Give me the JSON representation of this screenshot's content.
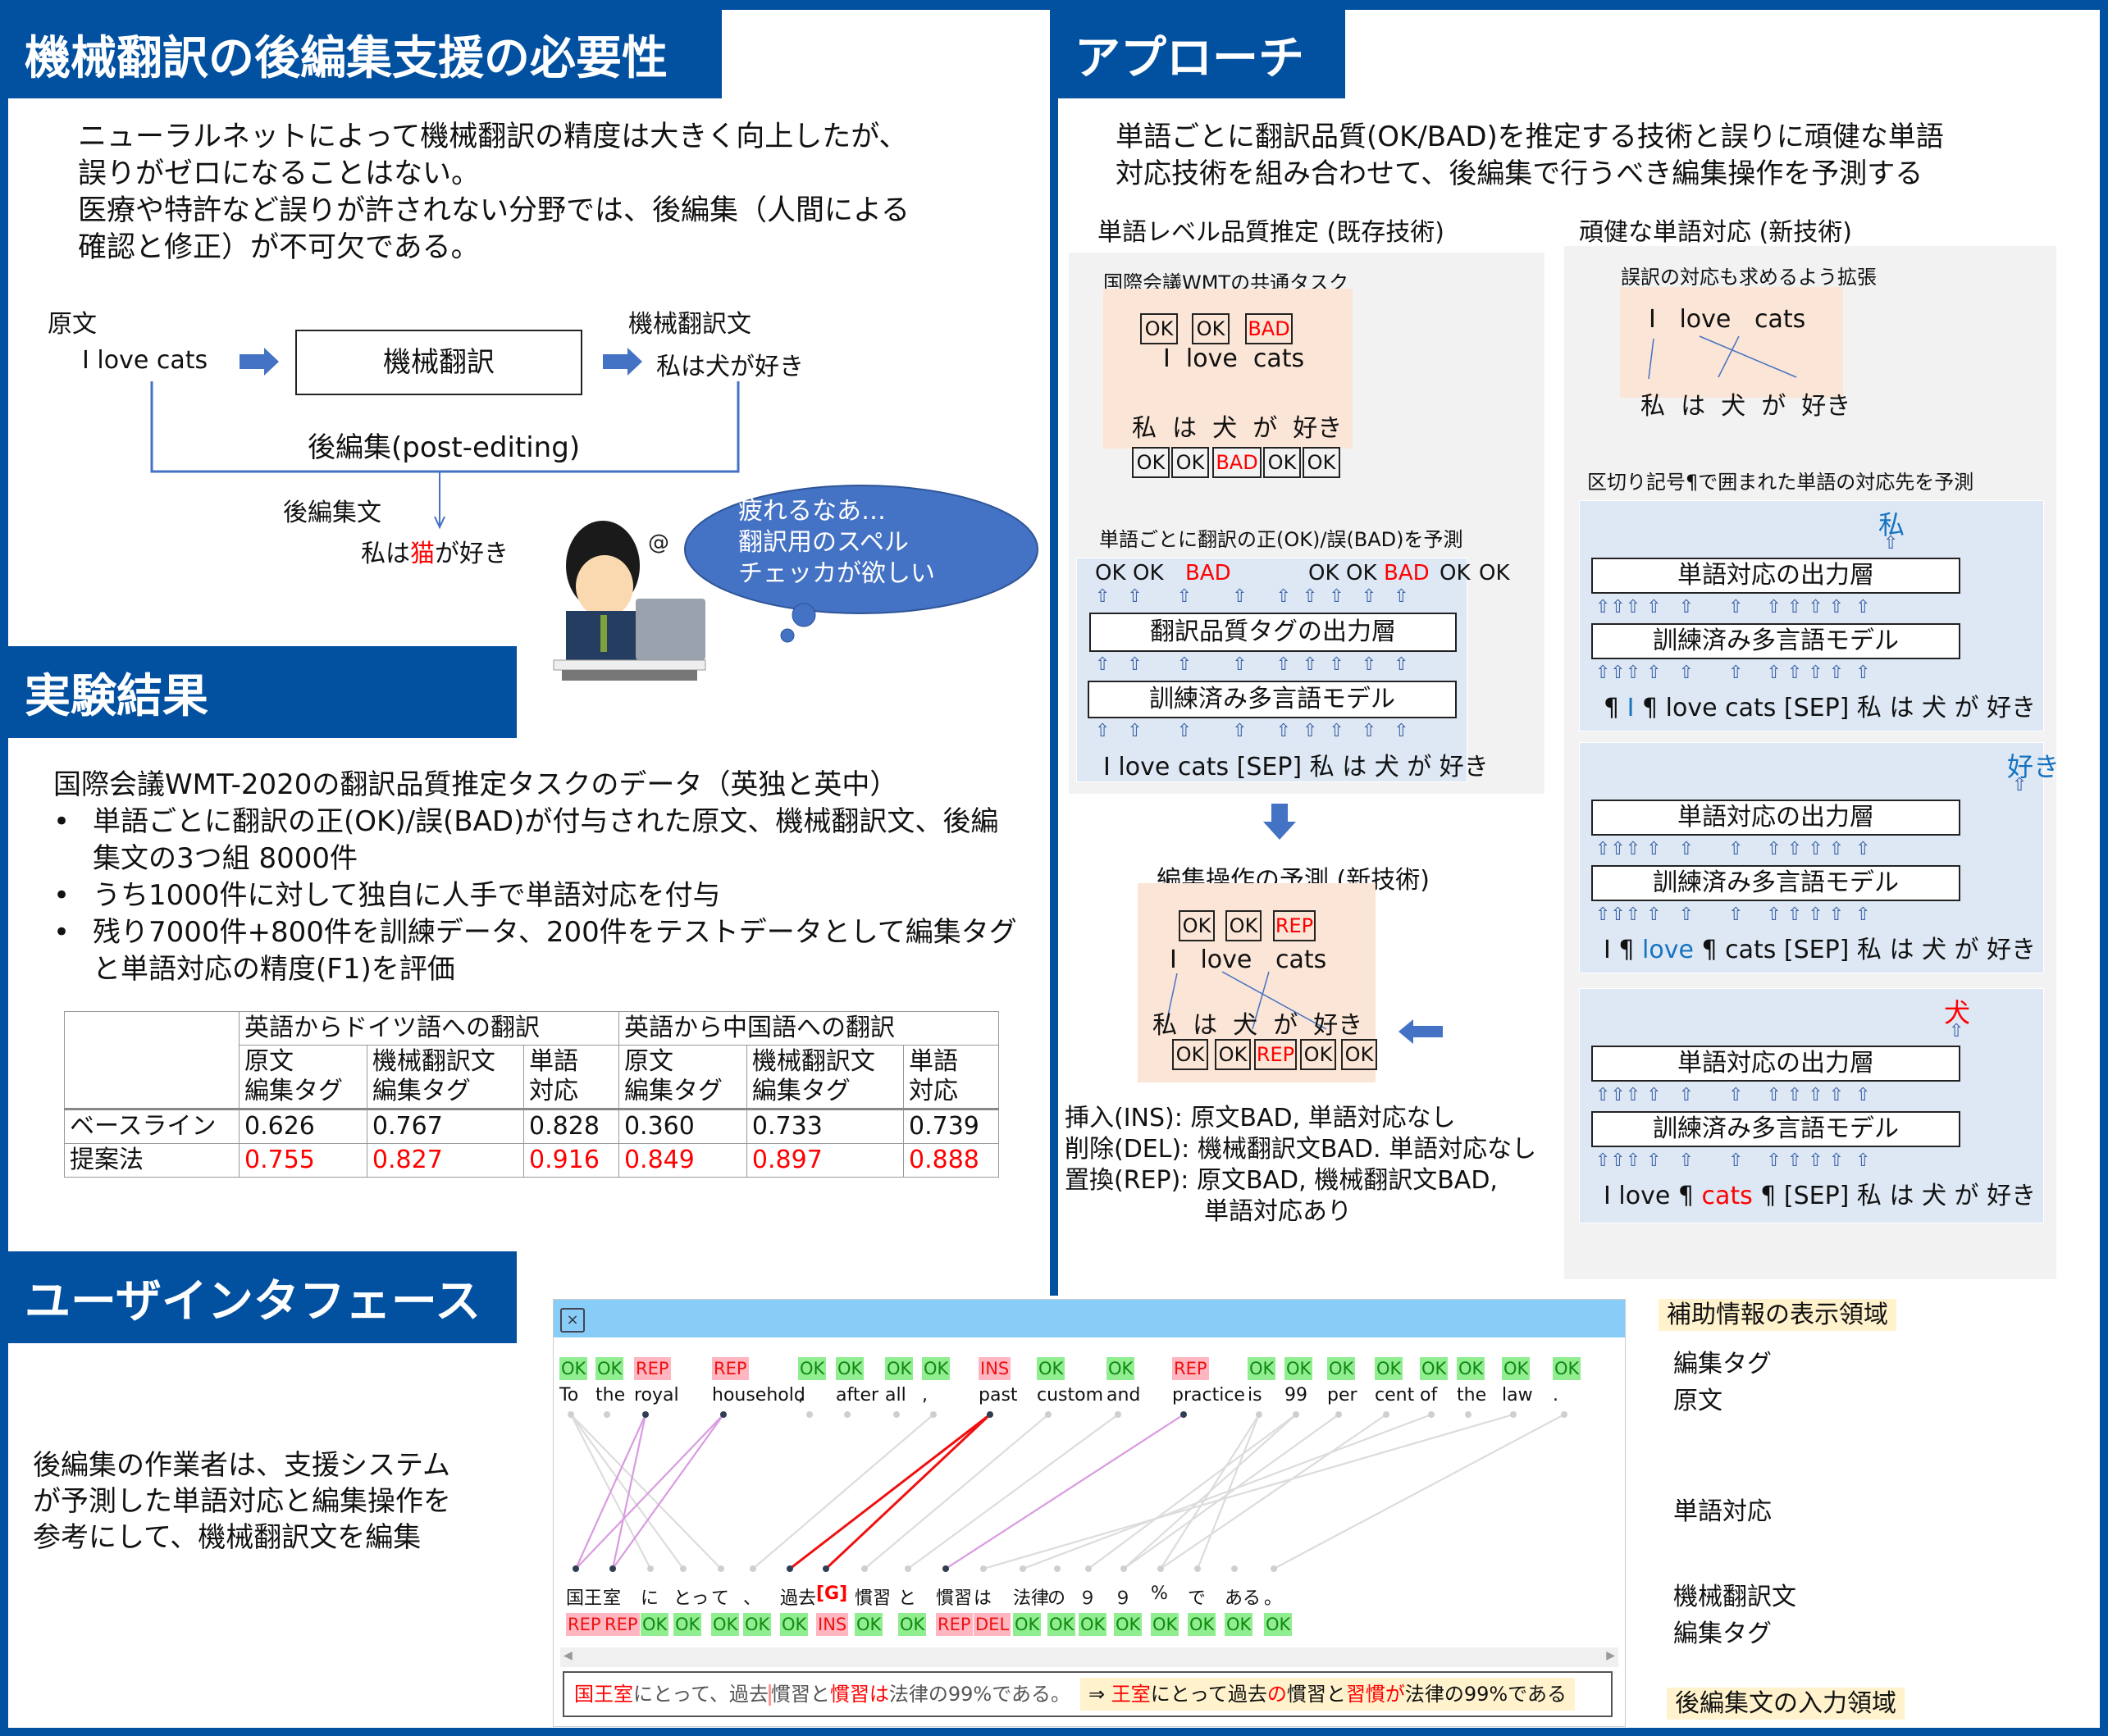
{
  "colors": {
    "brand": "#0250a0",
    "accent_red": "#ff0000",
    "accent_blue": "#1673c0",
    "peach": "#fbe5d6",
    "panel_blue": "#dee8f4",
    "panel_grey": "#f2f2f2",
    "tag_ok_bg": "#90ee90",
    "tag_bad_bg": "#ffb6c1",
    "ui_titlebar": "#87cdf7",
    "highlight": "#fff2cc"
  },
  "necessity": {
    "title": "機械翻訳の後編集支援の必要性",
    "para": [
      "ニューラルネットによって機械翻訳の精度は大きく向上したが、",
      "誤りがゼロになることはない。",
      "医療や特許など誤りが許されない分野では、後編集（人間による",
      "確認と修正）が不可欠である。"
    ],
    "diagram": {
      "source_label": "原文",
      "source_text": "I love cats",
      "mt_box": "機械翻訳",
      "mt_label": "機械翻訳文",
      "mt_text": "私は犬が好き",
      "pe_label": "後編集(post-editing)",
      "pe_out_label": "後編集文",
      "pe_out_pre": "私は",
      "pe_out_fix": "猫",
      "pe_out_post": "が好き"
    },
    "bubble": [
      "疲れるなあ…",
      "翻訳用のスペル",
      "チェッカが欲しい"
    ]
  },
  "results": {
    "title": "実験結果",
    "intro": "国際会議WMT-2020の翻訳品質推定タスクのデータ（英独と英中）",
    "bullets": [
      "単語ごとに翻訳の正(OK)/誤(BAD)が付与された原文、機械翻訳文、後編集文の3つ組 8000件",
      "うち1000件に対して独自に人手で単語対応を付与",
      "残り7000件+800件を訓練データ、200件をテストデータとして編集タグと単語対応の精度(F1)を評価"
    ],
    "table": {
      "groups": [
        "英語からドイツ語への翻訳",
        "英語から中国語への翻訳"
      ],
      "columns": [
        [
          "原文",
          "編集タグ"
        ],
        [
          "機械翻訳文",
          "編集タグ"
        ],
        [
          "単語",
          "対応"
        ],
        [
          "原文",
          "編集タグ"
        ],
        [
          "機械翻訳文",
          "編集タグ"
        ],
        [
          "単語",
          "対応"
        ]
      ],
      "rows": [
        {
          "name": "ベースライン",
          "values": [
            "0.626",
            "0.767",
            "0.828",
            "0.360",
            "0.733",
            "0.739"
          ]
        },
        {
          "name": "提案法",
          "values": [
            "0.755",
            "0.827",
            "0.916",
            "0.849",
            "0.897",
            "0.888"
          ]
        }
      ]
    }
  },
  "approach": {
    "title": "アプローチ",
    "summary": [
      "単語ごとに翻訳品質(OK/BAD)を推定する技術と誤りに頑健な単語",
      "対応技術を組み合わせて、後編集で行うべき編集操作を予測する"
    ],
    "qe": {
      "heading": "単語レベル品質推定 (既存技術)",
      "task_label": "国際会議WMTの共通タスク",
      "src_tags": [
        "OK",
        "OK",
        "BAD"
      ],
      "src_words": "I  love  cats",
      "tgt_words": "私  は  犬  が  好き",
      "tgt_tags": [
        "OK",
        "OK",
        "BAD",
        "OK",
        "OK"
      ],
      "predict_label": "単語ごとに翻訳の正(OK)/誤(BAD)を予測",
      "pred_row": [
        "OK",
        "OK",
        "BAD",
        "OK",
        "OK",
        "BAD",
        "OK",
        "OK"
      ],
      "output_layer": "翻訳品質タグの出力層",
      "model": "訓練済み多言語モデル",
      "input": "I love cats [SEP] 私 は 犬 が 好き"
    },
    "align": {
      "heading": "頑健な単語対応 (新技術)",
      "extend_label": "誤訳の対応も求めるよう拡張",
      "src_words": "I   love   cats",
      "tgt_words": "私  は  犬  が  好き",
      "predict_label": "区切り記号¶で囲まれた単語の対応先を予測",
      "output_layer": "単語対応の出力層",
      "model": "訓練済み多言語モデル",
      "examples": [
        {
          "output": "私",
          "input_pre": "¶ ",
          "input_hl": "I",
          "input_post": " ¶ love cats [SEP] 私 は 犬 が 好き",
          "hl_color": "blue"
        },
        {
          "output": "好き",
          "input_pre": "I ¶ ",
          "input_hl": "love",
          "input_post": " ¶ cats [SEP] 私 は 犬 が 好き",
          "hl_color": "blue"
        },
        {
          "output": "犬",
          "input_pre": "I love ¶ ",
          "input_hl": "cats",
          "input_post": " ¶ [SEP] 私 は 犬 が 好き",
          "hl_color": "red"
        }
      ]
    },
    "edit": {
      "heading": "編集操作の予測 (新技術)",
      "src_tags": [
        "OK",
        "OK",
        "REP"
      ],
      "src_words": "I   love   cats",
      "tgt_words": "私  は  犬  が  好き",
      "tgt_tags": [
        "OK",
        "OK",
        "REP",
        "OK",
        "OK"
      ],
      "rules": [
        "挿入(INS): 原文BAD, 単語対応なし",
        "削除(DEL): 機械翻訳文BAD. 単語対応なし",
        "置換(REP): 原文BAD, 機械翻訳文BAD,",
        "単語対応あり"
      ]
    }
  },
  "ui": {
    "title": "ユーザインタフェース",
    "desc": [
      "後編集の作業者は、支援システム",
      "が予測した単語対応と編集操作を",
      "参考にして、機械翻訳文を編集"
    ],
    "close_icon": "×",
    "source_tokens": [
      {
        "w": "To",
        "t": "OK"
      },
      {
        "w": "the",
        "t": "OK"
      },
      {
        "w": "royal",
        "t": "REP"
      },
      {
        "w": "household",
        "t": "REP"
      },
      {
        "w": ",",
        "t": "OK"
      },
      {
        "w": "after",
        "t": "OK"
      },
      {
        "w": "all",
        "t": "OK"
      },
      {
        "w": ",",
        "t": "OK"
      },
      {
        "w": "past",
        "t": "INS"
      },
      {
        "w": "custom",
        "t": "OK"
      },
      {
        "w": "and",
        "t": "OK"
      },
      {
        "w": "practice",
        "t": "REP"
      },
      {
        "w": "is",
        "t": "OK"
      },
      {
        "w": "99",
        "t": "OK"
      },
      {
        "w": "per",
        "t": "OK"
      },
      {
        "w": "cent",
        "t": "OK"
      },
      {
        "w": "of",
        "t": "OK"
      },
      {
        "w": "the",
        "t": "OK"
      },
      {
        "w": "law",
        "t": "OK"
      },
      {
        "w": ".",
        "t": "OK"
      }
    ],
    "target_tokens": [
      {
        "w": "国王",
        "t": "REP"
      },
      {
        "w": "室",
        "t": "REP"
      },
      {
        "w": "に",
        "t": "OK"
      },
      {
        "w": "とっ",
        "t": "OK"
      },
      {
        "w": "て",
        "t": "OK"
      },
      {
        "w": "、",
        "t": "OK"
      },
      {
        "w": "過去",
        "t": "OK"
      },
      {
        "w": "[G]",
        "t": "INS"
      },
      {
        "w": "慣習",
        "t": "OK"
      },
      {
        "w": "と",
        "t": "OK"
      },
      {
        "w": "慣習",
        "t": "REP"
      },
      {
        "w": "は",
        "t": "DEL"
      },
      {
        "w": "法律",
        "t": "OK"
      },
      {
        "w": "の",
        "t": "OK"
      },
      {
        "w": "９",
        "t": "OK"
      },
      {
        "w": "９",
        "t": "OK"
      },
      {
        "w": "%",
        "t": "OK"
      },
      {
        "w": "で",
        "t": "OK"
      },
      {
        "w": "ある",
        "t": "OK"
      },
      {
        "w": "。",
        "t": "OK"
      }
    ],
    "links": [
      {
        "s": 0,
        "t": 4,
        "k": "grey"
      },
      {
        "s": 0,
        "t": 3,
        "k": "grey"
      },
      {
        "s": 0,
        "t": 2,
        "k": "grey"
      },
      {
        "s": 2,
        "t": 0,
        "k": "pink"
      },
      {
        "s": 2,
        "t": 1,
        "k": "pink"
      },
      {
        "s": 3,
        "t": 0,
        "k": "pink"
      },
      {
        "s": 3,
        "t": 1,
        "k": "pink"
      },
      {
        "s": 7,
        "t": 5,
        "k": "grey"
      },
      {
        "s": 8,
        "t": 6,
        "k": "red"
      },
      {
        "s": 8,
        "t": 7,
        "k": "red"
      },
      {
        "s": 9,
        "t": 8,
        "k": "grey"
      },
      {
        "s": 10,
        "t": 9,
        "k": "grey"
      },
      {
        "s": 11,
        "t": 10,
        "k": "pink"
      },
      {
        "s": 12,
        "t": 16,
        "k": "grey"
      },
      {
        "s": 12,
        "t": 17,
        "k": "grey"
      },
      {
        "s": 13,
        "t": 14,
        "k": "grey"
      },
      {
        "s": 13,
        "t": 15,
        "k": "grey"
      },
      {
        "s": 14,
        "t": 15,
        "k": "grey"
      },
      {
        "s": 15,
        "t": 16,
        "k": "grey"
      },
      {
        "s": 16,
        "t": 12,
        "k": "grey"
      },
      {
        "s": 18,
        "t": 11,
        "k": "grey"
      },
      {
        "s": 19,
        "t": 19,
        "k": "grey"
      }
    ],
    "input_left": [
      {
        "t": "国王室",
        "c": "red"
      },
      {
        "t": "にとって、過去",
        "c": ""
      },
      {
        "t": "|",
        "c": "caret"
      },
      {
        "t": "慣習と",
        "c": ""
      },
      {
        "t": "慣習は",
        "c": "red"
      },
      {
        "t": "法律の99%である。",
        "c": ""
      }
    ],
    "input_right": [
      {
        "t": "⇒ ",
        "c": ""
      },
      {
        "t": "王室",
        "c": "red"
      },
      {
        "t": "にとって過去",
        "c": ""
      },
      {
        "t": "の",
        "c": "red"
      },
      {
        "t": "慣習と",
        "c": ""
      },
      {
        "t": "習慣が",
        "c": "red"
      },
      {
        "t": "法律の99%である",
        "c": ""
      }
    ],
    "annotations": {
      "aux_area": "補助情報の表示領域",
      "edit_tag": "編集タグ",
      "source": "原文",
      "alignment": "単語対応",
      "mt": "機械翻訳文",
      "edit_tag2": "編集タグ",
      "input_area": "後編集文の入力領域"
    }
  }
}
